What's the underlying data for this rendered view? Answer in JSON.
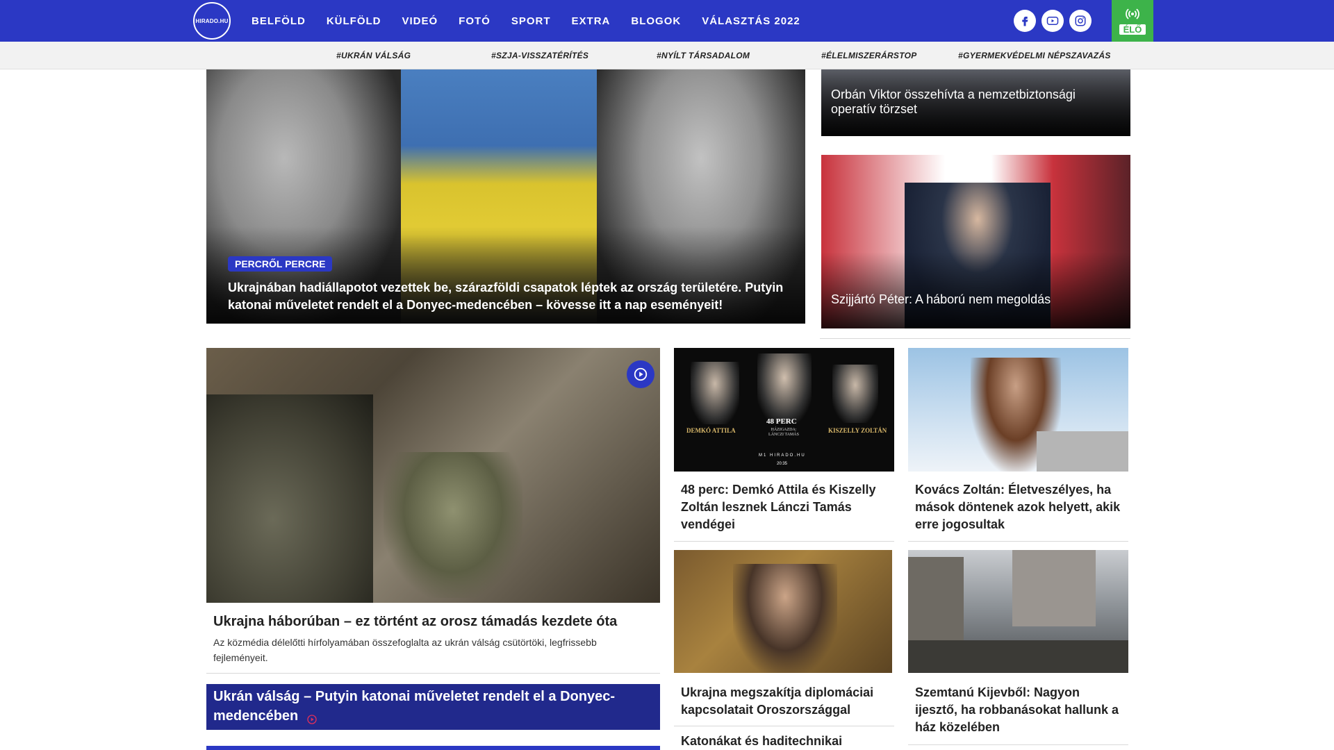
{
  "header": {
    "logo_text": "HIRADO.HU",
    "nav": [
      "BELFÖLD",
      "KÜLFÖLD",
      "VIDEÓ",
      "FOTÓ",
      "SPORT",
      "EXTRA",
      "BLOGOK",
      "VÁLASZTÁS 2022"
    ],
    "social": [
      "facebook-icon",
      "youtube-icon",
      "instagram-icon"
    ],
    "live_label": "ÉLŐ",
    "colors": {
      "brand": "#2b38c4",
      "live": "#3db34a",
      "banner": "#21298c"
    }
  },
  "tags": [
    "#UKRÁN VÁLSÁG",
    "#SZJA-VISSZATÉRÍTÉS",
    "#NYÍLT TÁRSADALOM",
    "#ÉLELMISZERÁRSTOP",
    "#GYERMEKVÉDELMI NÉPSZAVAZÁS"
  ],
  "hero": {
    "badge": "PERCRŐL PERCRE",
    "title": "Ukrajnában hadiállapotot vezettek be, szárazföldi csapatok léptek az ország területére. Putyin katonai műveletet rendelt el a Donyec-medencében – kövesse itt a nap eseményeit!"
  },
  "side": [
    {
      "title": "Orbán Viktor összehívta a nemzetbiztonsági operatív törzset"
    },
    {
      "title": "Szijjártó Péter: A háború nem megoldás"
    }
  ],
  "feature": {
    "title": "Ukrajna háborúban – ez történt az orosz támadás kezdete óta",
    "desc": "Az közmédia délelőtti hírfolyamában összefoglalta az ukrán válság csütörtöki, legfrissebb fejleményeit."
  },
  "grid": [
    {
      "title": "48 perc: Demkó Attila és Kiszelly Zoltán lesznek Lánczi Tamás vendégei",
      "thumb_text": {
        "left": "DEMKÓ ATTILA",
        "center": "48 PERC",
        "center_sub": "HÁZIGAZDA: LÁNCZI TAMÁS",
        "right": "KISZELLY ZOLTÁN",
        "brand": "M1 HIRADO.HU",
        "time": "20:35"
      }
    },
    {
      "title": "Kovács Zoltán: Életveszélyes, ha mások döntenek azok helyett, akik erre jogosultak"
    },
    {
      "title": "Ukrajna megszakítja diplomáciai kapcsolatait Oroszországgal"
    },
    {
      "title": "Szemtanú Kijevből: Nagyon ijesztő, ha robbanásokat hallunk a ház közelében"
    }
  ],
  "banner": {
    "title": "Ukrán válság – Putyin katonai műveletet rendelt el a Donyec-medencében"
  },
  "next": {
    "title": "Katonákat és haditechnikai"
  }
}
